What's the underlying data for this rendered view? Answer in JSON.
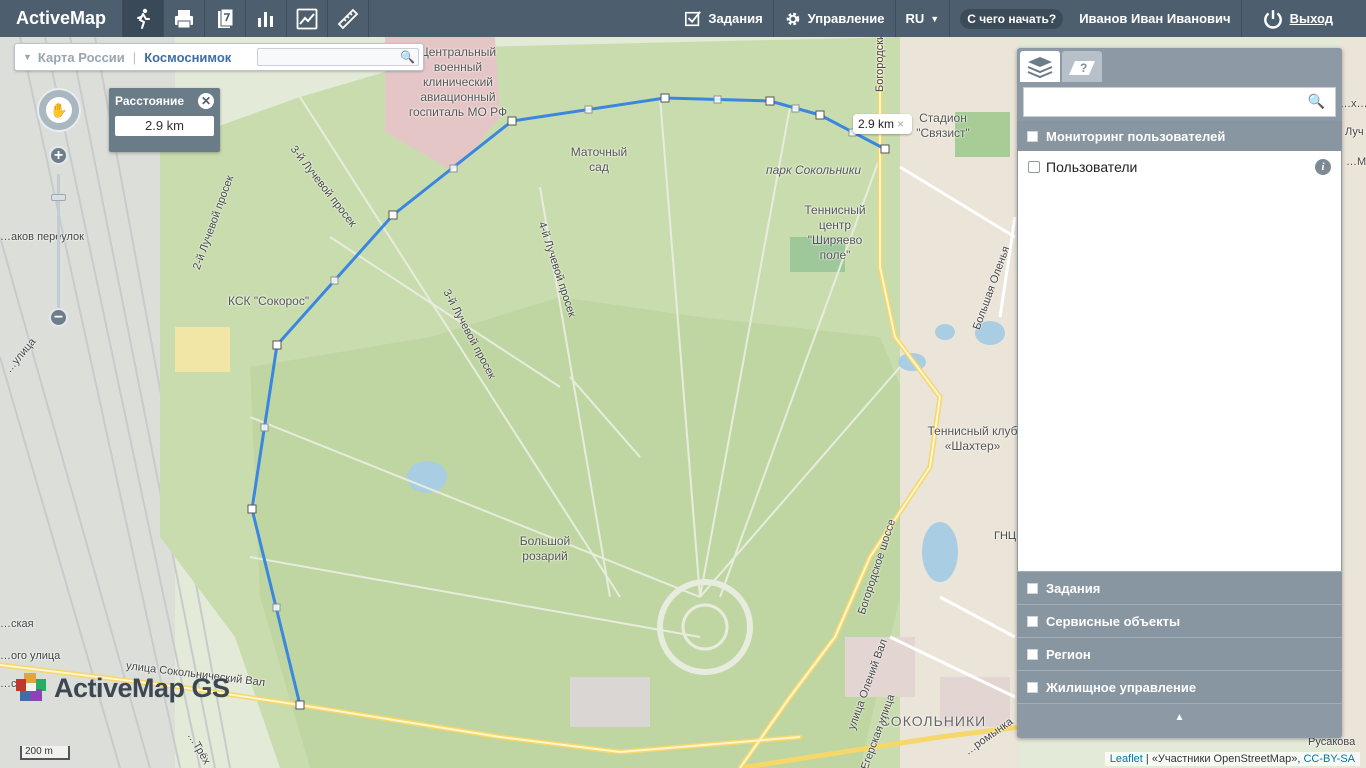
{
  "app": {
    "title": "ActiveMap"
  },
  "toolbar": {
    "tools": [
      "route-tool",
      "print-tool",
      "document-tool",
      "bar-chart-tool",
      "line-chart-tool",
      "ruler-tool"
    ]
  },
  "topnav": {
    "tasks_label": "Задания",
    "management_label": "Управление",
    "lang_label": "RU",
    "help_label": "С чего начать?",
    "user_name": "Иванов Иван Иванович",
    "logout_label": "Выход"
  },
  "map_switch": {
    "option1": "Карта России",
    "option2": "Космоснимок",
    "search_placeholder": ""
  },
  "distance": {
    "title": "Расстояние",
    "value": "2.9 km"
  },
  "tooltip": {
    "value": "2.9 km"
  },
  "panel": {
    "search_placeholder": "",
    "monitoring": {
      "label": "Мониторинг пользователей",
      "items": [
        {
          "label": "Пользователи"
        }
      ]
    },
    "sections": [
      {
        "label": "Задания"
      },
      {
        "label": "Сервисные объекты"
      },
      {
        "label": "Регион"
      },
      {
        "label": "Жилищное управление"
      }
    ]
  },
  "map_labels": {
    "hospital": "Центральный военный клинический авиационный госпиталь МО РФ",
    "garden": "Маточный сад",
    "park": "парк Сокольники",
    "tennis": "Теннисный центр \"Ширяево поле\"",
    "stadium": "Стадион \"Связист\"",
    "sokoros": "КСК \"Сокорос\"",
    "rosary": "Большой розарий",
    "tennis2": "Теннисный клуб «Шахтер»",
    "sokolniki": "СОКОЛЬНИКИ",
    "road1": "3-й Лучевой просек",
    "road2": "4-й Лучевой просек",
    "road3": "3-й Лучевой просек",
    "road4": "2-й Лучевой просек",
    "road5": "Богородское шоссе",
    "road6": "улица Олений Вал",
    "road7": "Егерская улица",
    "road8": "улица Сокольнический Вал",
    "road9": "Богородский",
    "road10": "Большая Оленья",
    "road11": "Русакова",
    "road12": "…аков переулок",
    "road13": "…улица",
    "road14": "…Трёх",
    "road15": "…ромынка",
    "road16": "…ская",
    "road17": "ГНЦ",
    "road18": "Луч",
    "road19": "…ого улица",
    "road20": "…ского",
    "road21": "…х…",
    "road22": "…Мещанка"
  },
  "branding": {
    "logo_text": "ActiveMap GS"
  },
  "scale": {
    "label": "200 m"
  },
  "attribution": {
    "leaflet": "Leaflet",
    "osm": "«Участники OpenStreetMap»",
    "license": "CC-BY-SA"
  }
}
